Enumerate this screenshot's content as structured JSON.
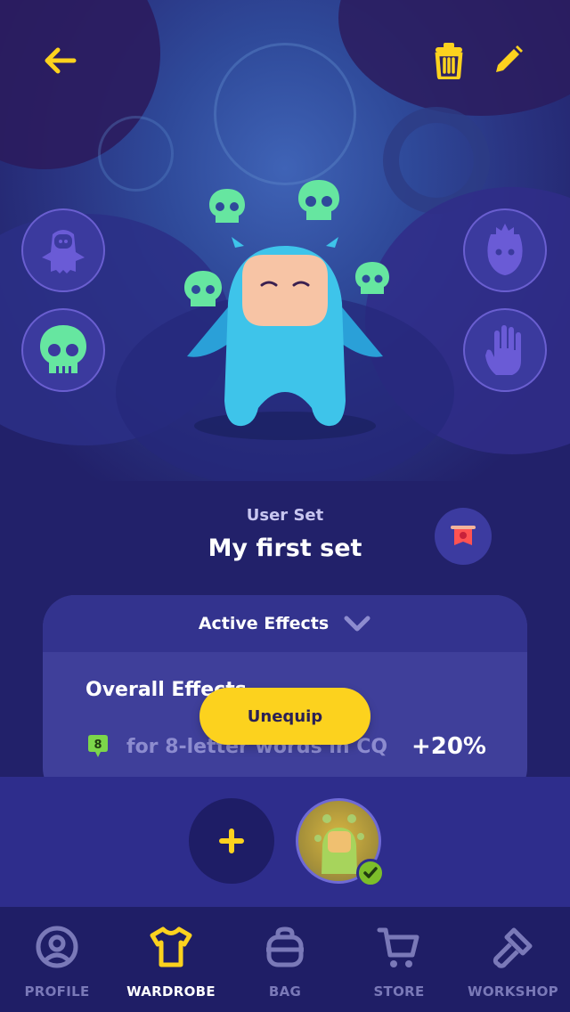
{
  "header": {
    "back_icon": "arrow-left-icon",
    "delete_icon": "trash-icon",
    "edit_icon": "pencil-icon"
  },
  "slots": {
    "left": [
      "head-slot-icon",
      "skull-aura-icon"
    ],
    "right": [
      "mask-slot-icon",
      "hand-slot-icon"
    ]
  },
  "set": {
    "subtitle": "User Set",
    "name": "My first set",
    "banner_icon": "banner-icon"
  },
  "effects": {
    "header_label": "Active Effects",
    "overall_label": "Overall Effects",
    "items": [
      {
        "badge": "8",
        "text": "for 8-letter words in CQ",
        "value": "+20%"
      }
    ]
  },
  "actions": {
    "unequip_label": "Unequip",
    "add_set_icon": "plus-icon"
  },
  "nav": {
    "items": [
      {
        "label": "PROFILE",
        "icon": "profile-icon",
        "active": false
      },
      {
        "label": "WARDROBE",
        "icon": "wardrobe-icon",
        "active": true
      },
      {
        "label": "BAG",
        "icon": "bag-icon",
        "active": false
      },
      {
        "label": "STORE",
        "icon": "cart-icon",
        "active": false
      },
      {
        "label": "WORKSHOP",
        "icon": "hammer-icon",
        "active": false
      }
    ]
  },
  "colors": {
    "accent_yellow": "#fcd21e",
    "skull_green": "#66e6a0",
    "background": "#22216a",
    "check_green": "#7cbe2a"
  }
}
